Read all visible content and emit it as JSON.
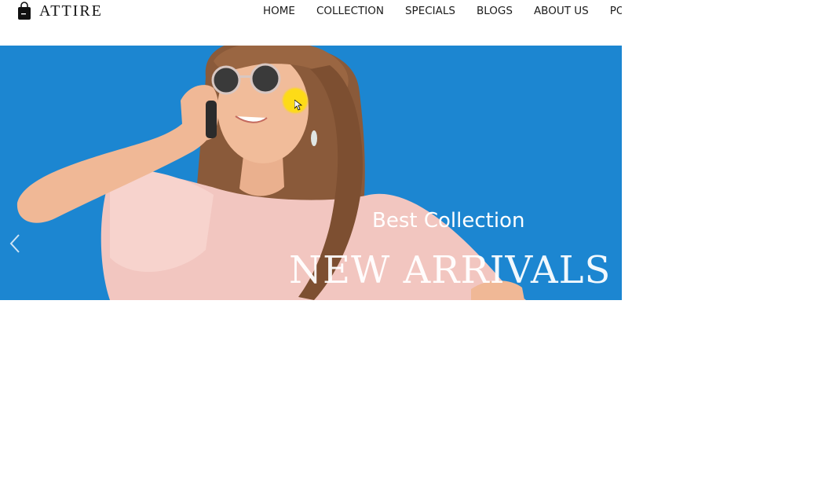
{
  "brand": {
    "name": "ATTIRE",
    "logo_icon": "shopping-bag-icon"
  },
  "nav": {
    "items": [
      {
        "label": "HOME"
      },
      {
        "label": "COLLECTION"
      },
      {
        "label": "SPECIALS"
      },
      {
        "label": "BLOGS"
      },
      {
        "label": "ABOUT US"
      },
      {
        "label": "POP"
      }
    ]
  },
  "hero": {
    "subtitle": "Best Collection",
    "title": "NEW ARRIVALS",
    "prev_icon": "chevron-left-icon",
    "background_color": "#1c86d1"
  },
  "colors": {
    "accent": "#1c86d1",
    "text_dark": "#1b1b1b",
    "cursor_highlight": "#ffe100"
  }
}
